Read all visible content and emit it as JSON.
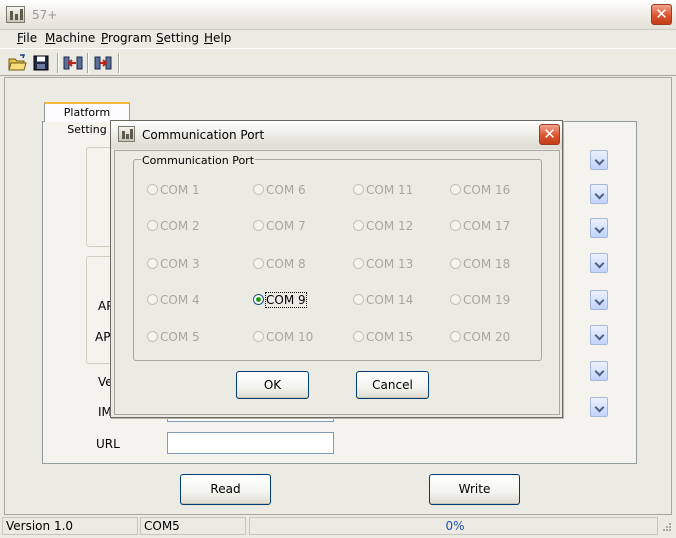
{
  "window": {
    "title": "57+"
  },
  "menu": [
    {
      "label": "File",
      "key": "F",
      "rest": "ile"
    },
    {
      "label": "Machine",
      "key": "M",
      "rest": "achine"
    },
    {
      "label": "Program",
      "key": "P",
      "rest": "rogram"
    },
    {
      "label": "Setting",
      "key": "S",
      "rest": "etting"
    },
    {
      "label": "Help",
      "key": "H",
      "rest": "elp"
    }
  ],
  "toolbar": {
    "icons": [
      "open-folder-icon",
      "save-disk-icon",
      "read-device-icon",
      "write-device-icon"
    ]
  },
  "platform": {
    "tab_label": "Platform Setting",
    "label_ap1": "AP",
    "label_ap2": "AP",
    "label_ve": "Ve",
    "label_im": "IM",
    "label_url": "URL",
    "read_button": "Read",
    "write_button": "Write"
  },
  "dialog": {
    "title": "Communication Port",
    "group_label": "Communication Port",
    "ports": [
      [
        "COM 1",
        "COM 6",
        "COM 11",
        "COM 16"
      ],
      [
        "COM 2",
        "COM 7",
        "COM 12",
        "COM 17"
      ],
      [
        "COM 3",
        "COM 8",
        "COM 13",
        "COM 18"
      ],
      [
        "COM 4",
        "COM 9",
        "COM 14",
        "COM 19"
      ],
      [
        "COM 5",
        "COM 10",
        "COM 15",
        "COM 20"
      ]
    ],
    "selected": "COM 9",
    "ok_label": "OK",
    "cancel_label": "Cancel"
  },
  "status": {
    "version": "Version 1.0",
    "port": "COM5",
    "progress": "0%"
  },
  "colors": {
    "selected_radio": "#21a121",
    "progress_text": "#1f4fb3",
    "close_button": "#d9542f"
  }
}
